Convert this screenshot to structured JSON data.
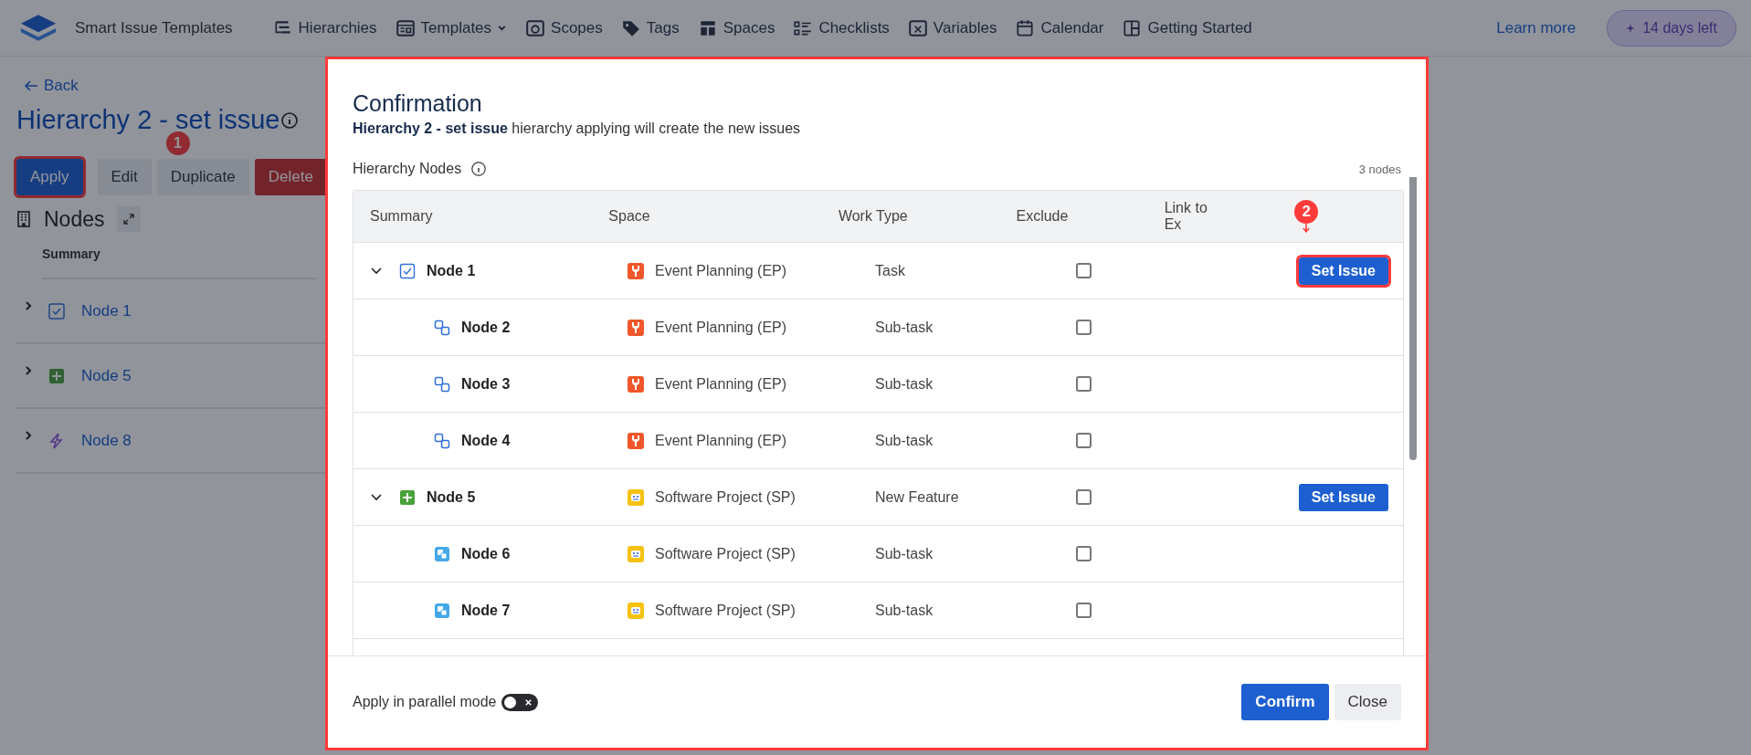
{
  "nav": {
    "app_name": "Smart Issue Templates",
    "items": [
      {
        "label": "Hierarchies",
        "kind": "hierarchy",
        "dropdown": false
      },
      {
        "label": "Templates",
        "kind": "template",
        "dropdown": true
      },
      {
        "label": "Scopes",
        "kind": "scope",
        "dropdown": false
      },
      {
        "label": "Tags",
        "kind": "tag",
        "dropdown": false
      },
      {
        "label": "Spaces",
        "kind": "space",
        "dropdown": false
      },
      {
        "label": "Checklists",
        "kind": "checklist",
        "dropdown": false
      },
      {
        "label": "Variables",
        "kind": "variable",
        "dropdown": false
      },
      {
        "label": "Calendar",
        "kind": "calendar",
        "dropdown": false
      },
      {
        "label": "Getting Started",
        "kind": "grid",
        "dropdown": false
      }
    ],
    "learn_more": "Learn more",
    "trial_badge": "14 days left"
  },
  "page": {
    "back": "Back",
    "title": "Hierarchy 2 - set issue",
    "buttons": [
      {
        "label": "Apply",
        "kind": "primary",
        "callout": "1"
      },
      {
        "label": "Edit",
        "kind": "default"
      },
      {
        "label": "Duplicate",
        "kind": "default"
      },
      {
        "label": "Delete",
        "kind": "danger"
      }
    ],
    "section_title": "Nodes",
    "column": "Summary",
    "nodes": [
      {
        "label": "Node 1",
        "kind": "task"
      },
      {
        "label": "Node 5",
        "kind": "feature"
      },
      {
        "label": "Node 8",
        "kind": "lightning"
      }
    ]
  },
  "dialog": {
    "title": "Confirmation",
    "subtitle": "**Hierarchy 2 - set issue** hierarchy applying will create the new issues",
    "nodes_label": "Hierarchy Nodes",
    "nodes_count": "3 nodes",
    "table": {
      "columns": [
        "Summary",
        "Space",
        "Work Type",
        "Exclude",
        "Link to Ex"
      ],
      "header_callout": "2",
      "rows": [
        {
          "summary": "Node 1",
          "kind": "task",
          "space": {
            "label": "Event Planning (EP)",
            "kind": "event"
          },
          "work_type": "Task",
          "exclude": false,
          "expanded": true,
          "action": "Set Issue",
          "highlighted": true,
          "children": [
            {
              "summary": "Node 2",
              "kind": "subtask",
              "space": {
                "label": "Event Planning (EP)",
                "kind": "event"
              },
              "work_type": "Sub-task",
              "exclude": false
            },
            {
              "summary": "Node 3",
              "kind": "subtask",
              "space": {
                "label": "Event Planning (EP)",
                "kind": "event"
              },
              "work_type": "Sub-task",
              "exclude": false
            },
            {
              "summary": "Node 4",
              "kind": "subtask",
              "space": {
                "label": "Event Planning (EP)",
                "kind": "event"
              },
              "work_type": "Sub-task",
              "exclude": false
            }
          ]
        },
        {
          "summary": "Node 5",
          "kind": "feature",
          "space": {
            "label": "Software Project (SP)",
            "kind": "software"
          },
          "work_type": "New Feature",
          "exclude": false,
          "expanded": true,
          "action": "Set Issue",
          "highlighted": false,
          "children": [
            {
              "summary": "Node 6",
              "kind": "subtask-filled",
              "space": {
                "label": "Software Project (SP)",
                "kind": "software"
              },
              "work_type": "Sub-task",
              "exclude": false
            },
            {
              "summary": "Node 7",
              "kind": "subtask-filled",
              "space": {
                "label": "Software Project (SP)",
                "kind": "software"
              },
              "work_type": "Sub-task",
              "exclude": false
            }
          ]
        }
      ]
    },
    "parallel_mode": {
      "label": "Apply in parallel mode",
      "on": false
    },
    "buttons": [
      {
        "label": "Confirm",
        "kind": "primary"
      },
      {
        "label": "Close",
        "kind": "default"
      }
    ]
  }
}
